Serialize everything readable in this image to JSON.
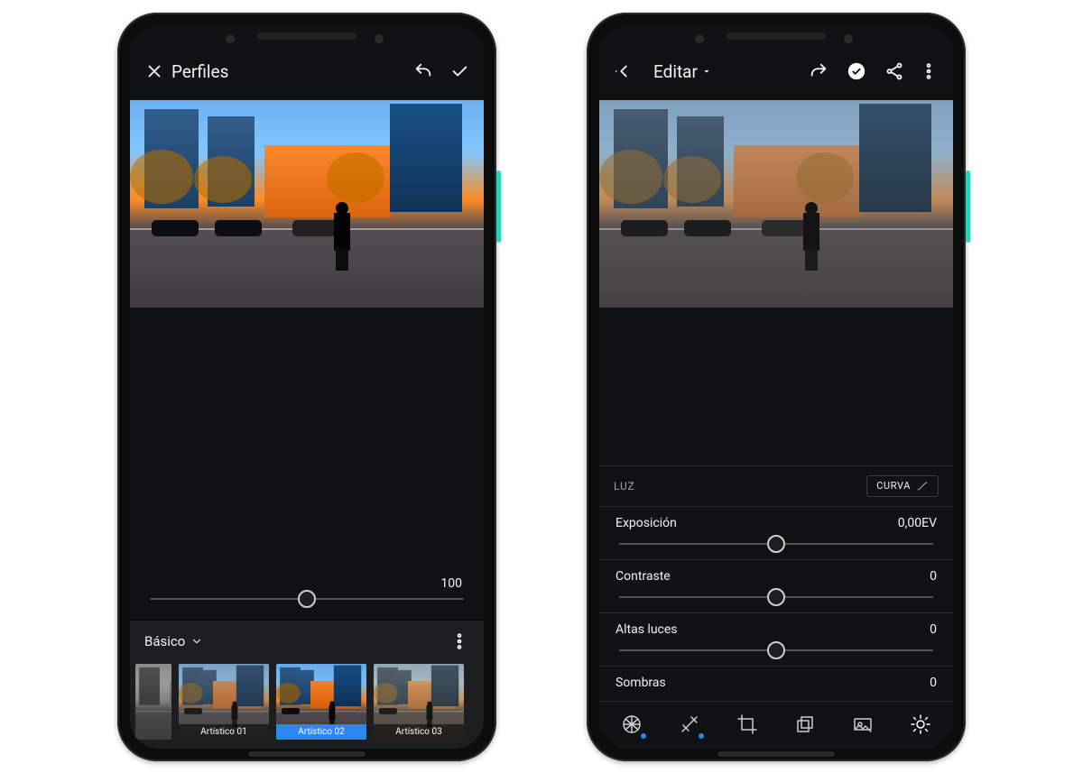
{
  "left": {
    "header": {
      "title": "Perfiles"
    },
    "intensity": {
      "value": 100,
      "thumb_pct": 50
    },
    "category": {
      "label": "Básico"
    },
    "thumbs": [
      {
        "label": "",
        "selected": false,
        "bw": true
      },
      {
        "label": "Artístico 01",
        "selected": false
      },
      {
        "label": "Artístico 02",
        "selected": true
      },
      {
        "label": "Artístico 03",
        "selected": false
      }
    ]
  },
  "right": {
    "header": {
      "title": "Editar"
    },
    "section": {
      "title": "LUZ",
      "curve_label": "CURVA"
    },
    "params": [
      {
        "label": "Exposición",
        "value": "0,00EV",
        "thumb_pct": 50
      },
      {
        "label": "Contraste",
        "value": "0",
        "thumb_pct": 50
      },
      {
        "label": "Altas luces",
        "value": "0",
        "thumb_pct": 50
      },
      {
        "label": "Sombras",
        "value": "0",
        "thumb_pct": 50
      }
    ],
    "tools": [
      {
        "name": "profiles",
        "active": false,
        "dot": true
      },
      {
        "name": "auto",
        "active": false,
        "dot": true
      },
      {
        "name": "crop",
        "active": false,
        "dot": false
      },
      {
        "name": "layers",
        "active": false,
        "dot": false
      },
      {
        "name": "presets",
        "active": false,
        "dot": false
      },
      {
        "name": "light",
        "active": true,
        "dot": false
      }
    ]
  }
}
